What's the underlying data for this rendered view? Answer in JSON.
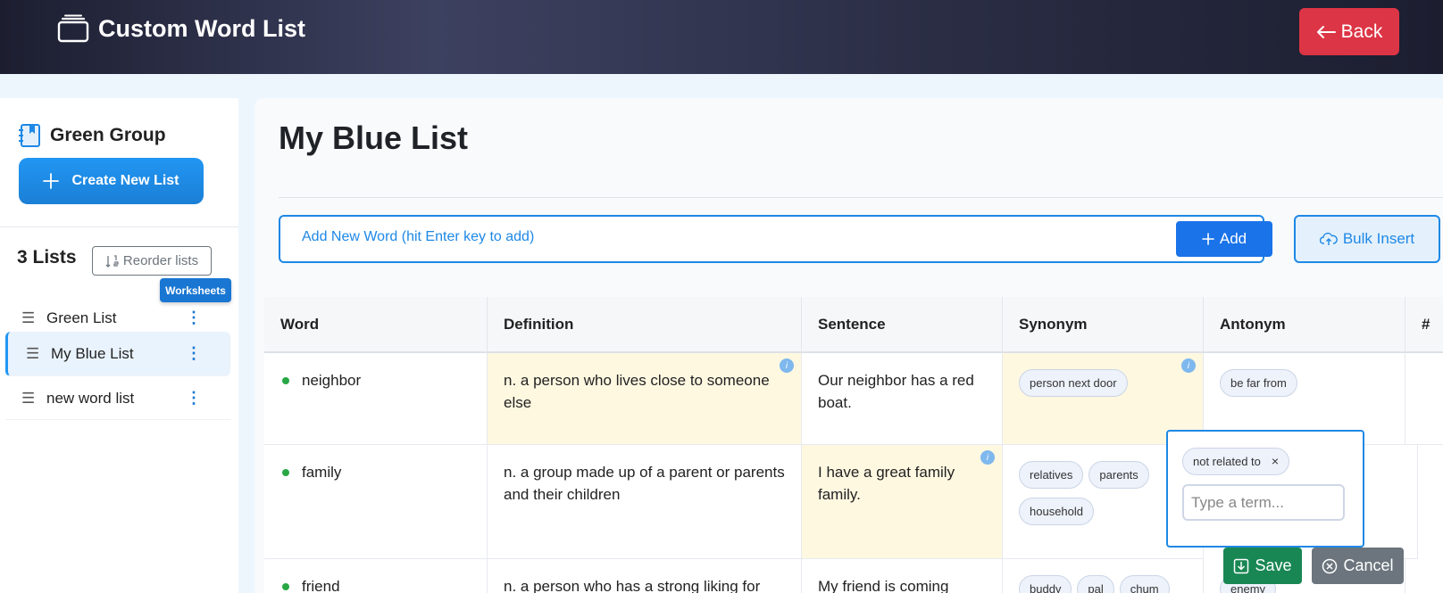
{
  "header": {
    "title": "Custom Word List",
    "back_label": "Back"
  },
  "sidebar": {
    "group_name": "Green Group",
    "create_label": "Create New List",
    "lists_count": "3 Lists",
    "reorder_label": "Reorder lists",
    "worksheets_label": "Worksheets",
    "items": [
      {
        "label": "Green List",
        "active": false
      },
      {
        "label": "My Blue List",
        "active": true
      },
      {
        "label": "new word list",
        "active": false
      }
    ]
  },
  "main": {
    "title": "My Blue List",
    "add_placeholder": "Add New Word (hit Enter key to add)",
    "add_label": "Add",
    "bulk_label": "Bulk Insert"
  },
  "table": {
    "columns": [
      "Word",
      "Definition",
      "Sentence",
      "Synonym",
      "Antonym",
      "#"
    ],
    "info_glyph": "i",
    "rows": [
      {
        "word": "neighbor",
        "definition": "n. a person who lives close to someone else",
        "sentence": "Our neighbor has a red boat.",
        "synonyms": [
          "person next door"
        ],
        "antonyms": [
          "be far from"
        ]
      },
      {
        "word": "family",
        "definition": "n. a group made up of a parent or parents and their children",
        "sentence": "I have a great family family.",
        "synonyms": [
          "relatives",
          "parents",
          "household"
        ],
        "antonyms": [
          "not related to"
        ]
      },
      {
        "word": "friend",
        "definition": "n. a person who has a strong liking for",
        "sentence": "My friend is coming",
        "synonyms": [
          "buddy",
          "pal",
          "chum"
        ],
        "antonyms": [
          "enemy"
        ]
      }
    ],
    "term_placeholder": "Type a term...",
    "save_label": "Save",
    "cancel_label": "Cancel",
    "remove_glyph": "×"
  },
  "colors": {
    "accent": "#1e88e5",
    "danger": "#dc3545",
    "success": "#198754",
    "highlight": "#fff8e1"
  }
}
